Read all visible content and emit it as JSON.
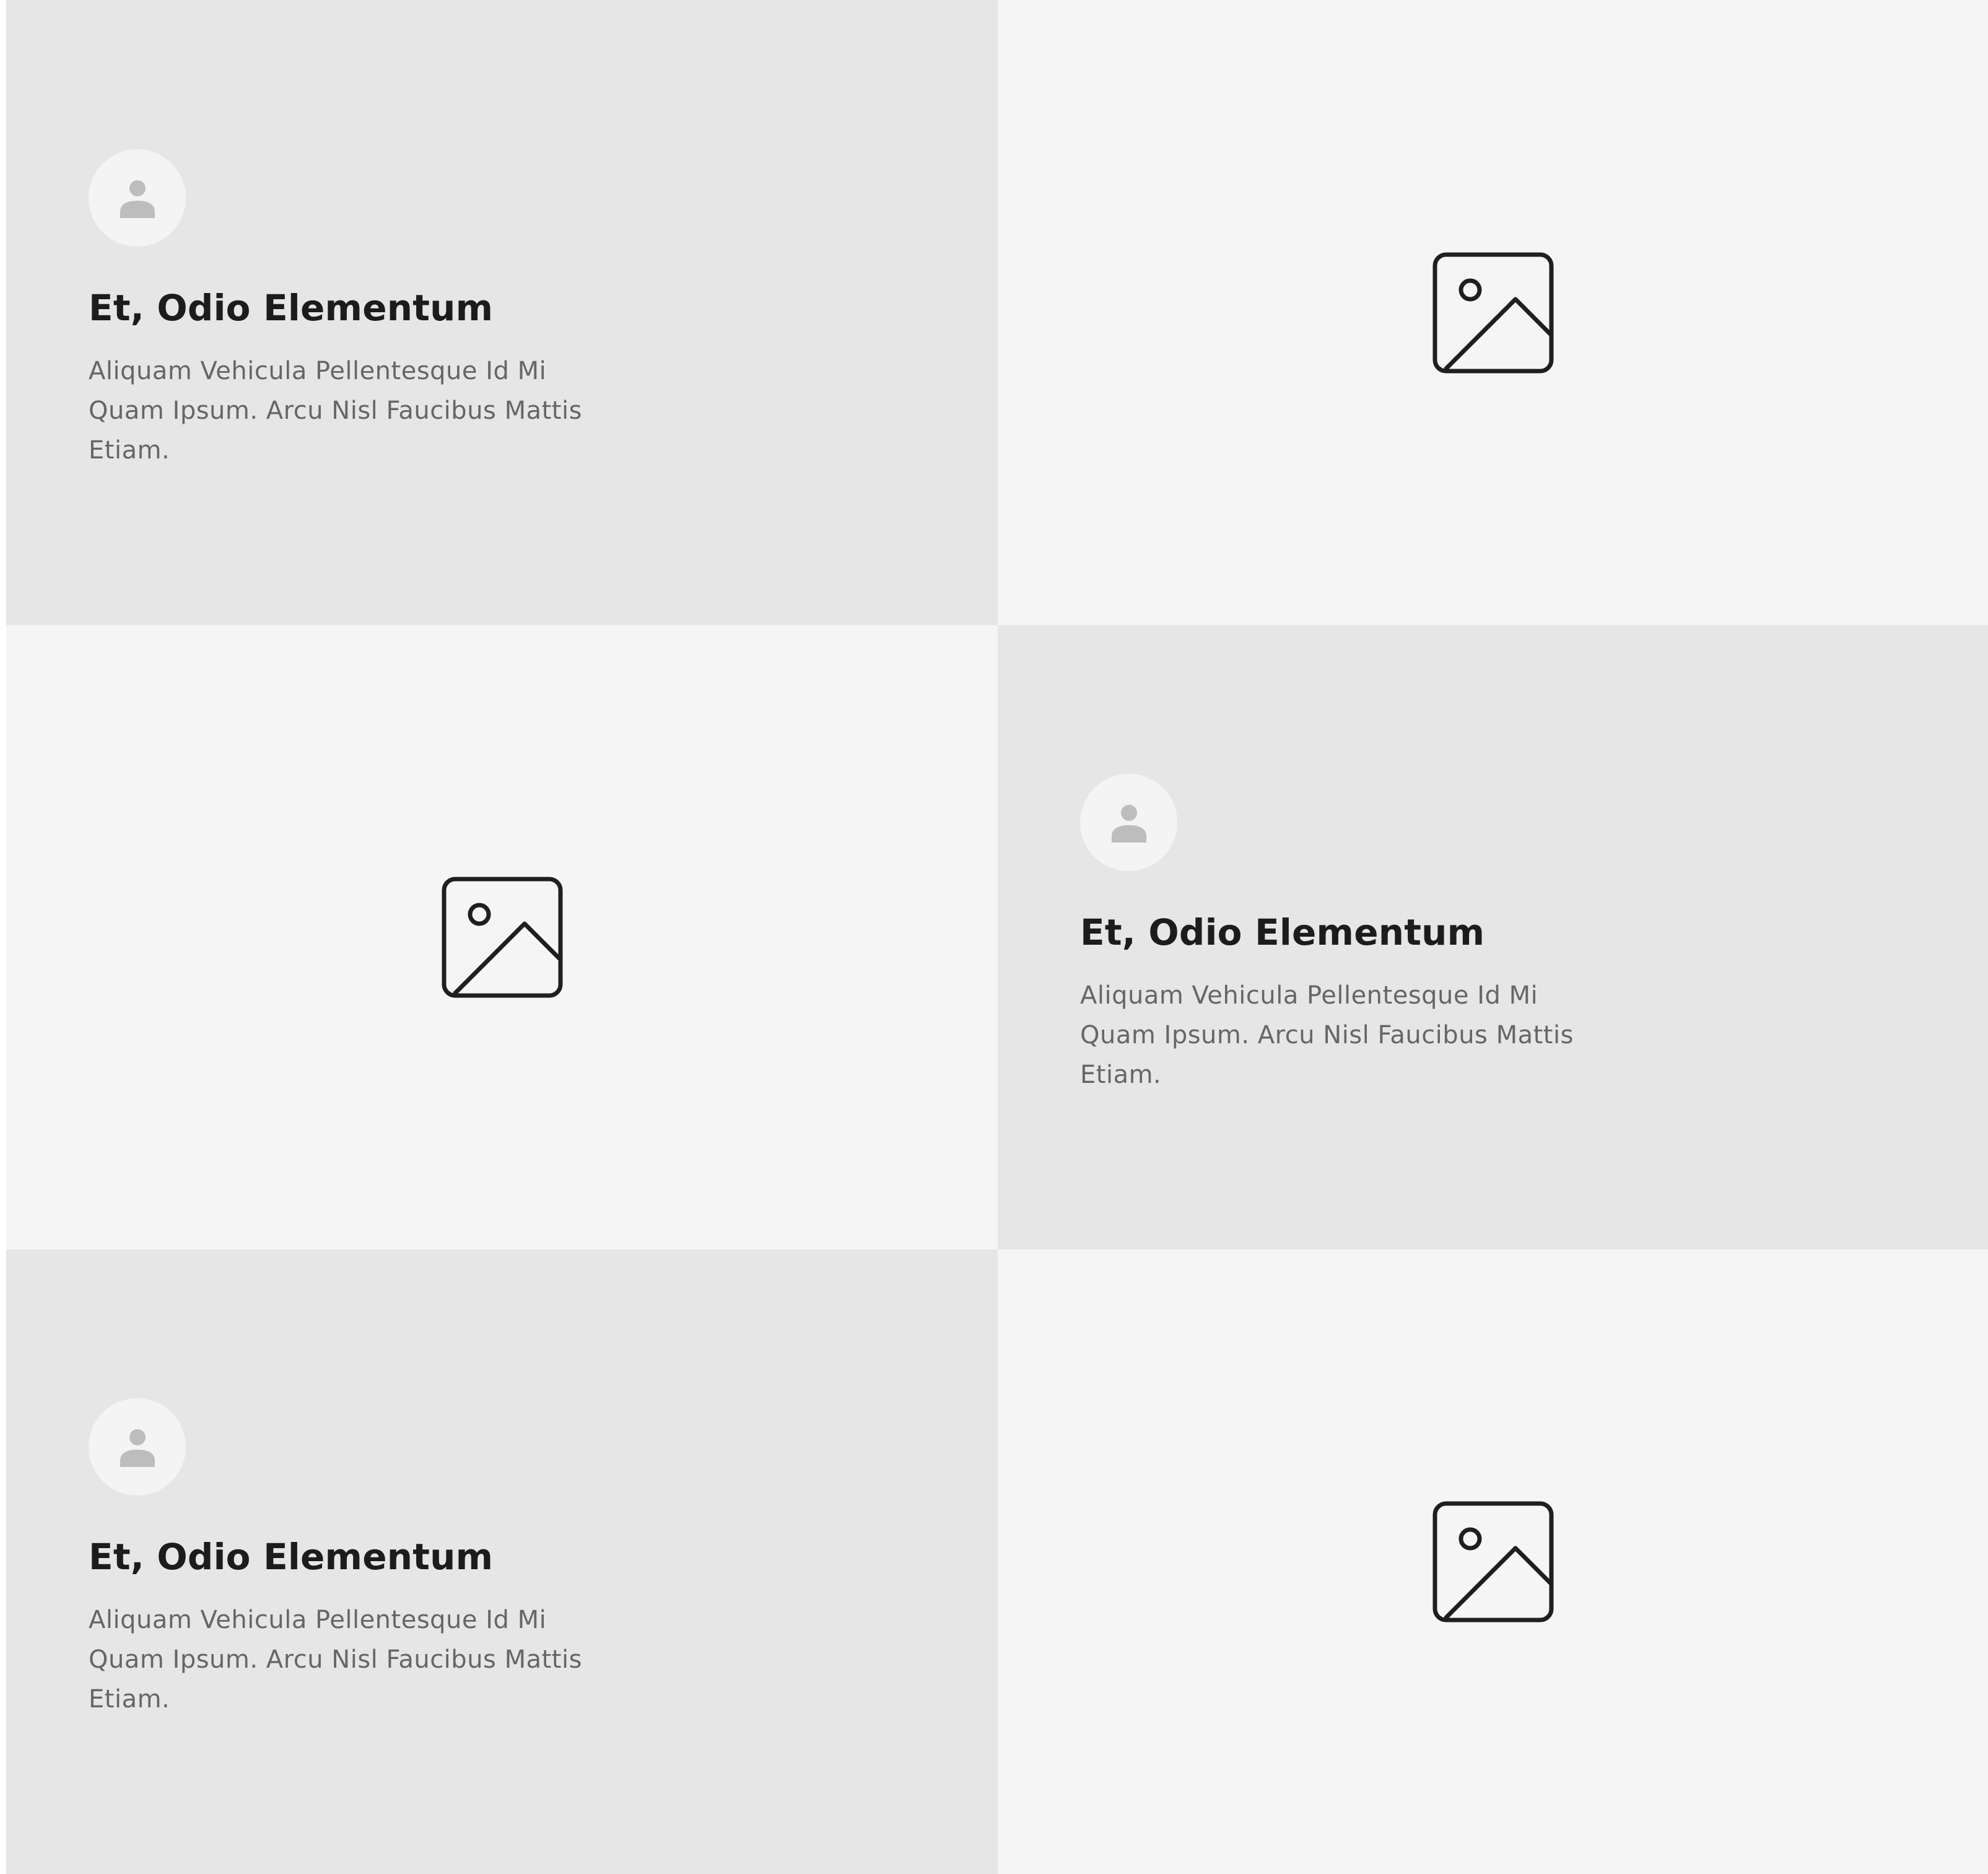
{
  "colors": {
    "panel_dark": "#e6e6e6",
    "panel_light": "#f5f5f5",
    "avatar_bg": "#f4f4f4",
    "avatar_icon": "#bdbdbd",
    "heading": "#1c1c1c",
    "body": "#666666",
    "image_icon": "#1f1f1f"
  },
  "rows": [
    {
      "feature": {
        "avatar_icon": "user-icon",
        "title": "Et, Odio Elementum",
        "description": "Aliquam Vehicula Pellentesque Id Mi Quam Ipsum. Arcu Nisl Faucibus Mattis Etiam."
      },
      "media": {
        "icon": "image-icon"
      }
    },
    {
      "feature": {
        "avatar_icon": "user-icon",
        "title": "Et, Odio Elementum",
        "description": "Aliquam Vehicula Pellentesque Id Mi Quam Ipsum. Arcu Nisl Faucibus Mattis Etiam."
      },
      "media": {
        "icon": "image-icon"
      }
    },
    {
      "feature": {
        "avatar_icon": "user-icon",
        "title": "Et, Odio Elementum",
        "description": "Aliquam Vehicula Pellentesque Id Mi Quam Ipsum. Arcu Nisl Faucibus Mattis Etiam."
      },
      "media": {
        "icon": "image-icon"
      }
    }
  ]
}
